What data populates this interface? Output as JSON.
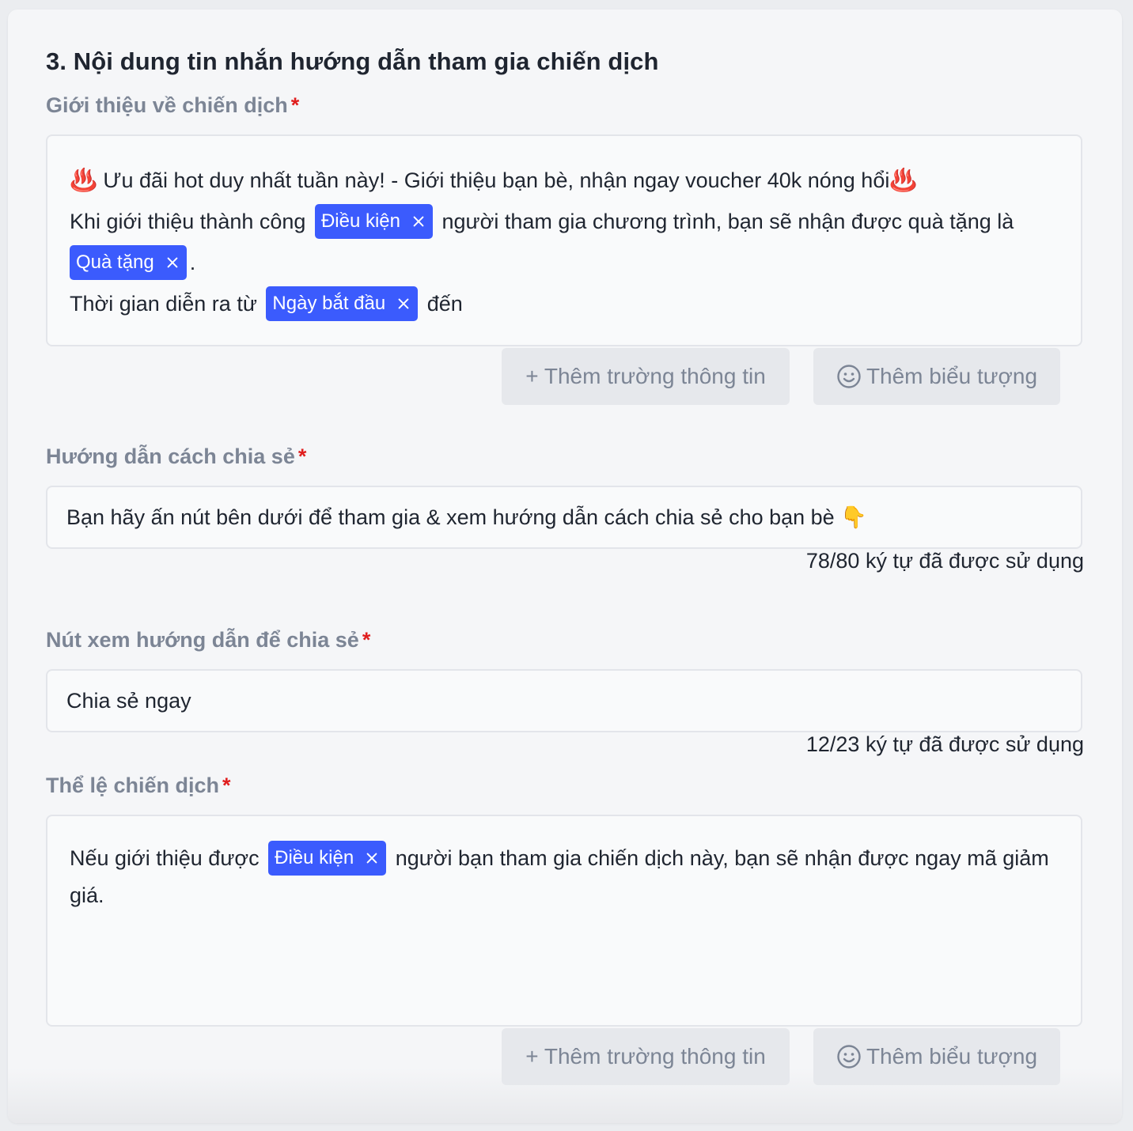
{
  "section_title": "3. Nội dung tin nhắn hướng dẫn tham gia chiến dịch",
  "required_mark": "*",
  "intro": {
    "label": "Giới thiệu về chiến dịch",
    "emoji_hot": "♨️",
    "line1_text": "Ưu đãi hot duy nhất tuần này! - Giới thiệu bạn bè, nhận ngay voucher 40k nóng hổi",
    "line2_before": "Khi giới thiệu thành công",
    "chip_condition": "Điều kiện",
    "line2_after": "người tham gia chương trình, bạn sẽ nhận được quà tặng là",
    "chip_gift": "Quà tặng",
    "line3_after": ".",
    "line4_before": "Thời gian diễn ra từ",
    "chip_start_date": "Ngày bắt đầu",
    "line4_after": "đến"
  },
  "toolbar": {
    "add_field_label": "+ Thêm trường thông tin",
    "add_icon_label": "Thêm biểu tượng"
  },
  "share_guide": {
    "label": "Hướng dẫn cách chia sẻ",
    "value": "Bạn hãy ấn nút bên dưới để tham gia & xem hướng dẫn cách chia sẻ cho bạn bè 👇",
    "counter": "78/80 ký tự đã được sử dụng"
  },
  "share_button": {
    "label": "Nút xem hướng dẫn để chia sẻ",
    "value": "Chia sẻ ngay",
    "counter": "12/23 ký tự đã được sử dụng"
  },
  "rules": {
    "label": "Thể lệ chiến dịch",
    "before": "Nếu giới thiệu được",
    "chip_condition": "Điều kiện",
    "after": "người bạn tham gia chiến dịch này, bạn sẽ nhận được ngay mã giảm giá."
  },
  "colors": {
    "chip_bg": "#3b5bfd",
    "required": "#e01e1e",
    "label": "#7c8595",
    "button_bg": "#e6e8ec"
  },
  "icons": {
    "chip_remove": "close-icon",
    "add_icon_button": "smiley-icon"
  }
}
